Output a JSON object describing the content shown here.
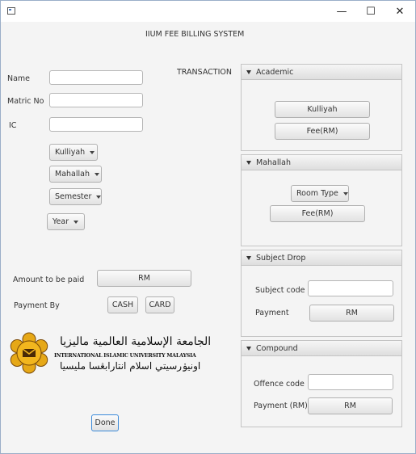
{
  "window": {
    "minimize_glyph": "—",
    "maximize_glyph": "☐",
    "close_glyph": "✕"
  },
  "app_title": "IIUM FEE BILLING SYSTEM",
  "form": {
    "name_label": "Name",
    "name_value": "",
    "matric_label": "Matric No",
    "matric_value": "",
    "ic_label": "IC",
    "ic_value": ""
  },
  "dropdowns": {
    "kulliyah": "Kulliyah",
    "mahallah": "Mahallah",
    "semester": "Semester",
    "year": "Year"
  },
  "transaction_label": "TRANSACTION",
  "amount": {
    "label": "Amount to be paid",
    "button": "RM"
  },
  "payment": {
    "label": "Payment By",
    "cash": "CASH",
    "card": "CARD"
  },
  "logo": {
    "arabic_top": "الجامعة الإسلامية العالمية ماليزيا",
    "english": "INTERNATIONAL ISLAMIC UNIVERSITY MALAYSIA",
    "jawi": "اونيۏرسيتي اسلام انتارابڠسا مليسيا"
  },
  "done_button": "Done",
  "panes": {
    "academic": {
      "title": "Academic",
      "kulliyah_button": "Kulliyah",
      "fee_button": "Fee(RM)"
    },
    "mahallah": {
      "title": "Mahallah",
      "room_type": "Room Type",
      "fee_button": "Fee(RM)"
    },
    "subject_drop": {
      "title": "Subject Drop",
      "code_label": "Subject code",
      "code_value": "",
      "payment_label": "Payment",
      "payment_button": "RM"
    },
    "compound": {
      "title": "Compound",
      "code_label": "Offence code",
      "code_value": "",
      "payment_label": "Payment (RM)",
      "payment_button": "RM"
    }
  }
}
